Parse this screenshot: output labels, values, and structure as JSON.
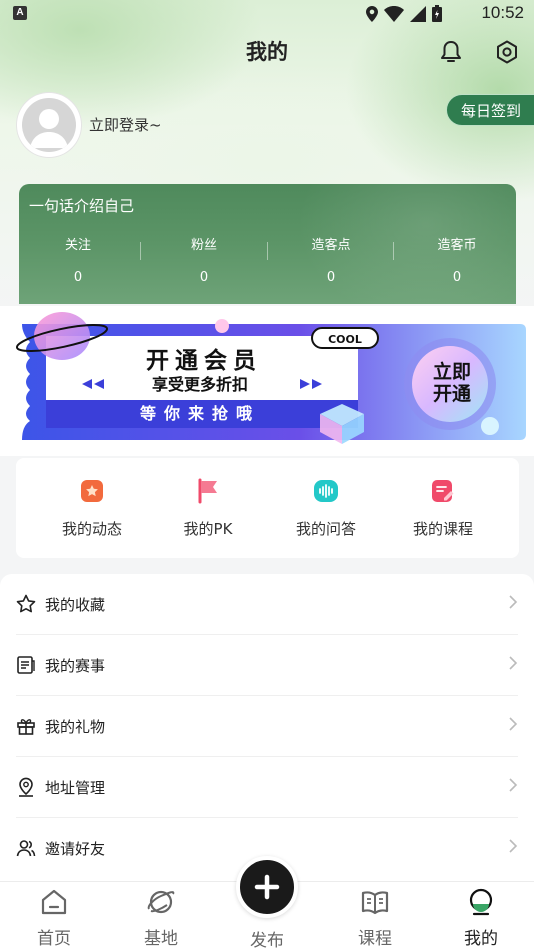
{
  "status_bar": {
    "carrier_icon": "A",
    "time": "10:52"
  },
  "header": {
    "title": "我的"
  },
  "profile": {
    "login_text": "立即登录~",
    "checkin_label": "每日签到"
  },
  "stats_card": {
    "bio": "一句话介绍自己",
    "items": [
      {
        "label": "关注",
        "value": "0"
      },
      {
        "label": "粉丝",
        "value": "0"
      },
      {
        "label": "造客点",
        "value": "0"
      },
      {
        "label": "造客币",
        "value": "0"
      }
    ]
  },
  "banner": {
    "headline": "开通会员",
    "subline": "享受更多折扣",
    "tagline": "等你来抢哦",
    "badge": "COOL",
    "button_line1": "立即",
    "button_line2": "开通"
  },
  "quick_actions": [
    {
      "label": "我的动态",
      "icon": "star-badge-icon",
      "color": "#f26a3d"
    },
    {
      "label": "我的PK",
      "icon": "flag-icon",
      "color": "#f04a6a"
    },
    {
      "label": "我的问答",
      "icon": "voice-wave-icon",
      "color": "#23c8c8"
    },
    {
      "label": "我的课程",
      "icon": "edit-note-icon",
      "color": "#f04a6a"
    }
  ],
  "menu": [
    {
      "label": "我的收藏",
      "icon": "star-icon"
    },
    {
      "label": "我的赛事",
      "icon": "document-icon"
    },
    {
      "label": "我的礼物",
      "icon": "gift-icon"
    },
    {
      "label": "地址管理",
      "icon": "location-icon"
    },
    {
      "label": "邀请好友",
      "icon": "users-icon"
    }
  ],
  "tabbar": {
    "items": [
      {
        "label": "首页",
        "icon": "home-icon"
      },
      {
        "label": "基地",
        "icon": "planet-icon"
      },
      {
        "label": "发布",
        "icon": "plus-icon"
      },
      {
        "label": "课程",
        "icon": "book-icon"
      },
      {
        "label": "我的",
        "icon": "profile-face-icon"
      }
    ],
    "active": "我的"
  },
  "colors": {
    "accent_green": "#2f7d4f",
    "stats_green": "#5c9567",
    "banner_blue": "#4a53e6"
  }
}
